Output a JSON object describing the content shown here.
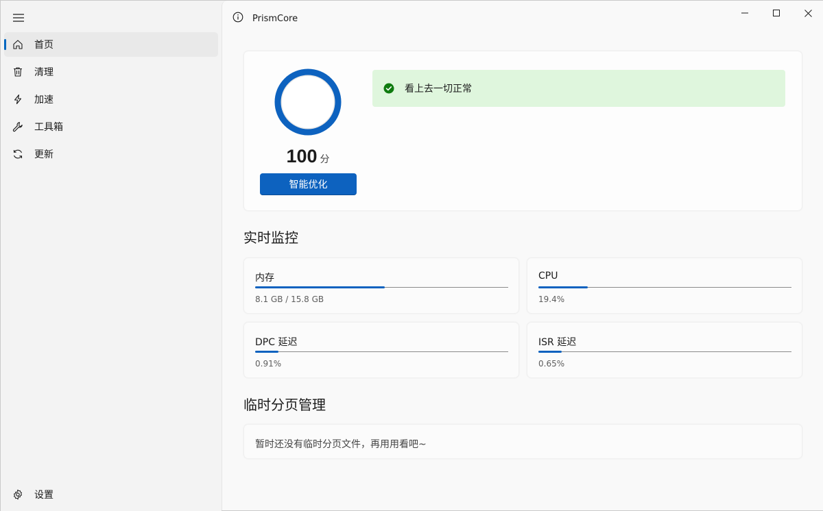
{
  "app": {
    "title": "PrismCore"
  },
  "sidebar": {
    "items": [
      {
        "label": "首页",
        "icon": "home-icon",
        "active": true
      },
      {
        "label": "清理",
        "icon": "trash-icon",
        "active": false
      },
      {
        "label": "加速",
        "icon": "lightning-icon",
        "active": false
      },
      {
        "label": "工具箱",
        "icon": "wrench-icon",
        "active": false
      },
      {
        "label": "更新",
        "icon": "refresh-icon",
        "active": false
      }
    ],
    "settings_label": "设置"
  },
  "score": {
    "value": "100",
    "unit": "分",
    "button_label": "智能优化",
    "ring_fraction": 1.0
  },
  "status": {
    "text": "看上去一切正常",
    "color": "#dff6dd"
  },
  "monitor": {
    "title": "实时监控",
    "memory": {
      "label": "内存",
      "value": "8.1 GB  /  15.8 GB",
      "fraction": 0.513
    },
    "cpu": {
      "label": "CPU",
      "value": "19.4%",
      "fraction": 0.194
    },
    "dpc": {
      "label": "DPC 延迟",
      "value": "0.91%",
      "fraction": 0.0091
    },
    "isr": {
      "label": "ISR 延迟",
      "value": "0.65%",
      "fraction": 0.0065
    }
  },
  "pagefile": {
    "title": "临时分页管理",
    "empty_text": "暂时还没有临时分页文件，再用用看吧~"
  },
  "colors": {
    "accent": "#0d62bf",
    "success": "#0f7b0f"
  }
}
